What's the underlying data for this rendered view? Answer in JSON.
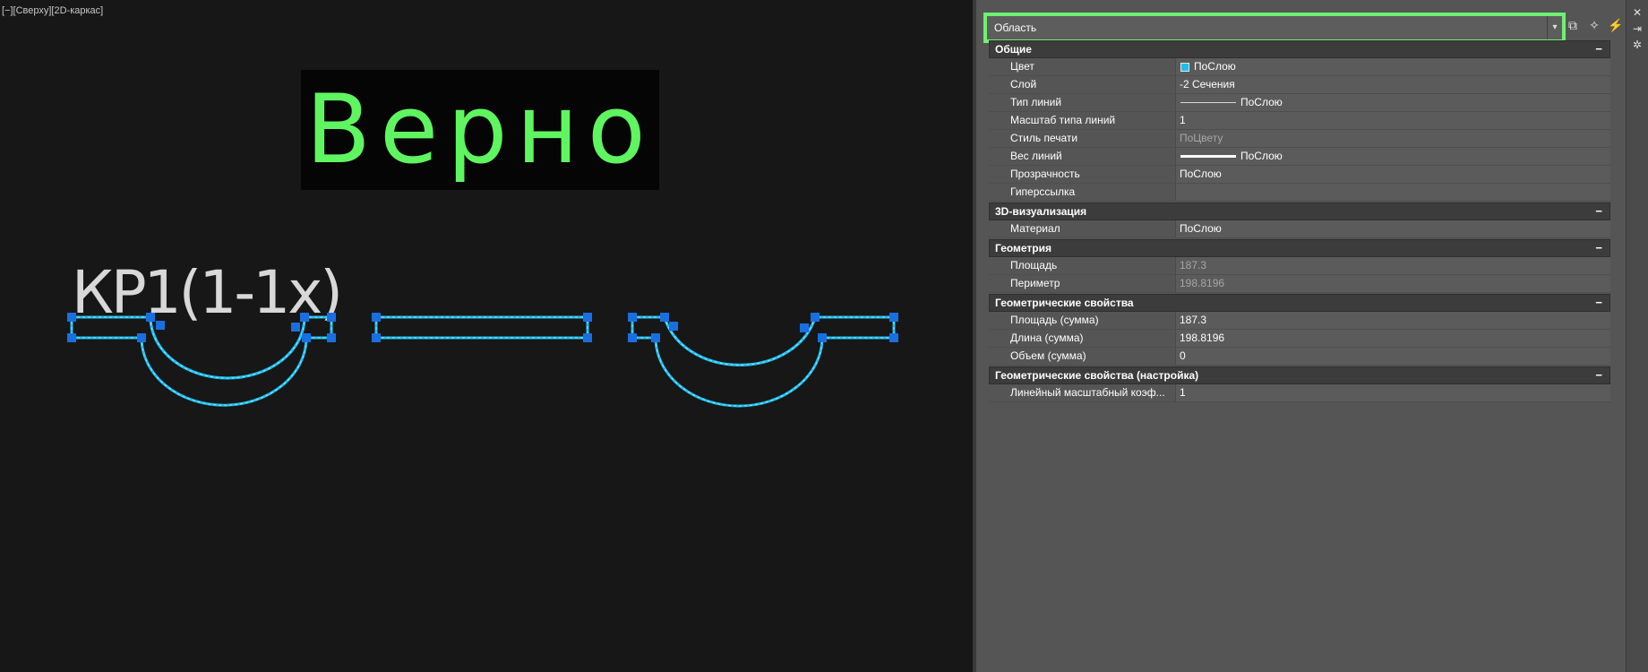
{
  "viewport": {
    "label": "[−][Сверху][2D-каркас]",
    "banner_text": "Верно",
    "drawing_label": "КР1(1-1х)"
  },
  "panel": {
    "selector_value": "Область",
    "sections": [
      {
        "title": "Общие",
        "toggle": "−",
        "rows": [
          {
            "name": "Цвет",
            "value": "ПоСлою",
            "kind": "color",
            "dim": false
          },
          {
            "name": "Слой",
            "value": "-2 Сечения",
            "kind": "text",
            "dim": false
          },
          {
            "name": "Тип линий",
            "value": "ПоСлою",
            "kind": "line",
            "dim": false
          },
          {
            "name": "Масштаб типа линий",
            "value": "1",
            "kind": "text",
            "dim": false
          },
          {
            "name": "Стиль печати",
            "value": "ПоЦвету",
            "kind": "text",
            "dim": true
          },
          {
            "name": "Вес линий",
            "value": "ПоСлою",
            "kind": "heavyline",
            "dim": false
          },
          {
            "name": "Прозрачность",
            "value": "ПоСлою",
            "kind": "text",
            "dim": false
          },
          {
            "name": "Гиперссылка",
            "value": "",
            "kind": "text",
            "dim": false
          }
        ]
      },
      {
        "title": "3D-визуализация",
        "toggle": "−",
        "rows": [
          {
            "name": "Материал",
            "value": "ПоСлою",
            "kind": "text",
            "dim": false
          }
        ]
      },
      {
        "title": "Геометрия",
        "toggle": "−",
        "rows": [
          {
            "name": "Площадь",
            "value": "187.3",
            "kind": "text",
            "dim": true
          },
          {
            "name": "Периметр",
            "value": "198.8196",
            "kind": "text",
            "dim": true
          }
        ]
      },
      {
        "title": "Геометрические свойства",
        "toggle": "−",
        "rows": [
          {
            "name": "Площадь (сумма)",
            "value": "187.3",
            "kind": "text",
            "dim": false
          },
          {
            "name": "Длина (сумма)",
            "value": "198.8196",
            "kind": "text",
            "dim": false
          },
          {
            "name": "Объем (сумма)",
            "value": "0",
            "kind": "text",
            "dim": false
          }
        ]
      },
      {
        "title": "Геометрические свойства (настройка)",
        "toggle": "−",
        "rows": [
          {
            "name": "Линейный масштабный коэф...",
            "value": "1",
            "kind": "text",
            "dim": false
          }
        ]
      }
    ]
  },
  "icons": {
    "toggle_pickadd": "toggle-pickadd-icon",
    "select_objects": "select-objects-icon",
    "quick_select": "quick-select-icon",
    "close": "close-icon",
    "auto_hide": "auto-hide-icon",
    "palette_settings": "palette-settings-icon"
  },
  "colors": {
    "banner_text": "#5ff560",
    "selection_highlight": "#6ef071",
    "grip": "#1a6fe0",
    "selected_outline": "#1ebef0"
  }
}
